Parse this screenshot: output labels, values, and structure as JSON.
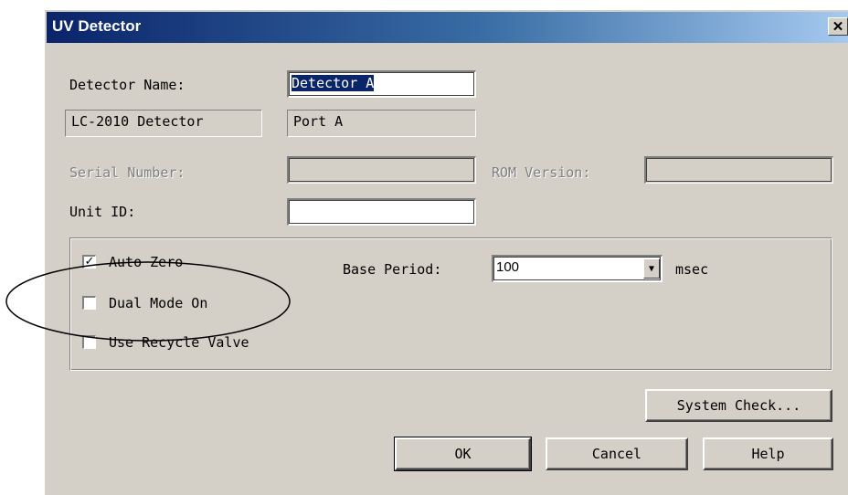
{
  "window": {
    "title": "UV Detector",
    "close_icon": "close-icon"
  },
  "detector_name": {
    "label": "Detector Name:",
    "value": "Detector A"
  },
  "model": {
    "name": "LC-2010 Detector",
    "port": "Port A"
  },
  "serial_number": {
    "label": "Serial Number:",
    "value": ""
  },
  "rom_version": {
    "label": "ROM Version:",
    "value": ""
  },
  "unit_id": {
    "label": "Unit ID:",
    "value": ""
  },
  "options": [
    {
      "label": "Auto Zero",
      "checked": true
    },
    {
      "label": "Dual Mode On",
      "checked": false
    },
    {
      "label": "Use Recycle Valve",
      "checked": false
    }
  ],
  "base_period": {
    "label": "Base Period:",
    "value": "100",
    "unit": "msec"
  },
  "buttons": {
    "system_check": "System Check...",
    "ok": "OK",
    "cancel": "Cancel",
    "help": "Help"
  },
  "colors": {
    "title_start": "#0a246a",
    "title_end": "#a6caf0",
    "face": "#d4d0c8",
    "selection": "#0a246a"
  }
}
